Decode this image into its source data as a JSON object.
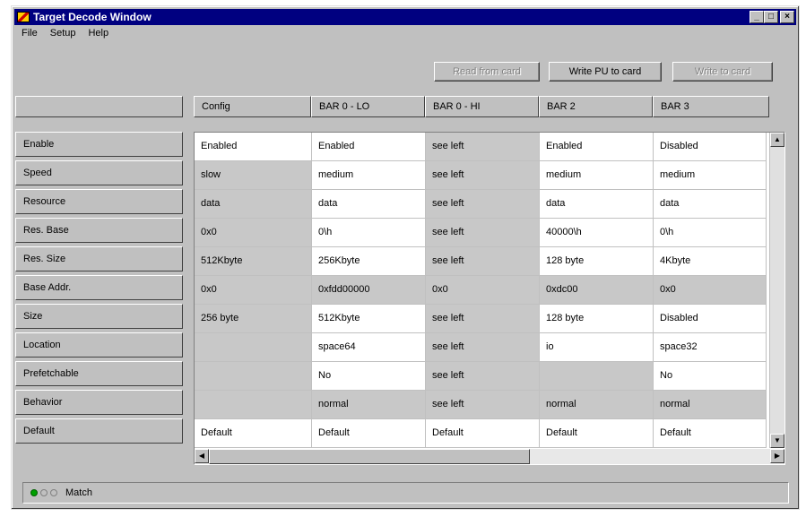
{
  "window": {
    "title": "Target Decode Window"
  },
  "menu": {
    "file": "File",
    "setup": "Setup",
    "help": "Help"
  },
  "toolbar": {
    "read_label": "Read from card",
    "write_pu_label": "Write PU to card",
    "write_label": "Write to card"
  },
  "columns": [
    "Config",
    "BAR 0 - LO",
    "BAR 0 - HI",
    "BAR 2",
    "BAR 3"
  ],
  "rows": [
    {
      "label": "Enable",
      "cells": [
        "Enabled",
        "Enabled",
        "see left",
        "Enabled",
        "Disabled"
      ],
      "gray": [
        false,
        false,
        true,
        false,
        false
      ]
    },
    {
      "label": "Speed",
      "cells": [
        "slow",
        "medium",
        "see left",
        "medium",
        "medium"
      ],
      "gray": [
        true,
        false,
        true,
        false,
        false
      ]
    },
    {
      "label": "Resource",
      "cells": [
        "data",
        "data",
        "see left",
        "data",
        "data"
      ],
      "gray": [
        true,
        false,
        true,
        false,
        false
      ]
    },
    {
      "label": "Res. Base",
      "cells": [
        "0x0",
        "0\\h",
        "see left",
        "40000\\h",
        "0\\h"
      ],
      "gray": [
        true,
        false,
        true,
        false,
        false
      ]
    },
    {
      "label": "Res. Size",
      "cells": [
        "512Kbyte",
        "256Kbyte",
        "see left",
        "128 byte",
        "4Kbyte"
      ],
      "gray": [
        true,
        false,
        true,
        false,
        false
      ]
    },
    {
      "label": "Base Addr.",
      "cells": [
        "0x0",
        "0xfdd00000",
        "0x0",
        "0xdc00",
        "0x0"
      ],
      "gray": [
        true,
        true,
        true,
        true,
        true
      ]
    },
    {
      "label": "Size",
      "cells": [
        "256 byte",
        "512Kbyte",
        "see left",
        "128 byte",
        "Disabled"
      ],
      "gray": [
        true,
        false,
        true,
        false,
        false
      ]
    },
    {
      "label": "Location",
      "cells": [
        "",
        "space64",
        "see left",
        "io",
        "space32"
      ],
      "gray": [
        true,
        false,
        true,
        false,
        false
      ]
    },
    {
      "label": "Prefetchable",
      "cells": [
        "",
        "No",
        "see left",
        "",
        "No"
      ],
      "gray": [
        true,
        false,
        true,
        true,
        false
      ]
    },
    {
      "label": "Behavior",
      "cells": [
        "",
        "normal",
        "see left",
        "normal",
        "normal"
      ],
      "gray": [
        true,
        true,
        true,
        true,
        true
      ]
    },
    {
      "label": "Default",
      "cells": [
        "Default",
        "Default",
        "Default",
        "Default",
        "Default"
      ],
      "gray": [
        false,
        false,
        false,
        false,
        false
      ]
    }
  ],
  "status": {
    "text": "Match"
  }
}
